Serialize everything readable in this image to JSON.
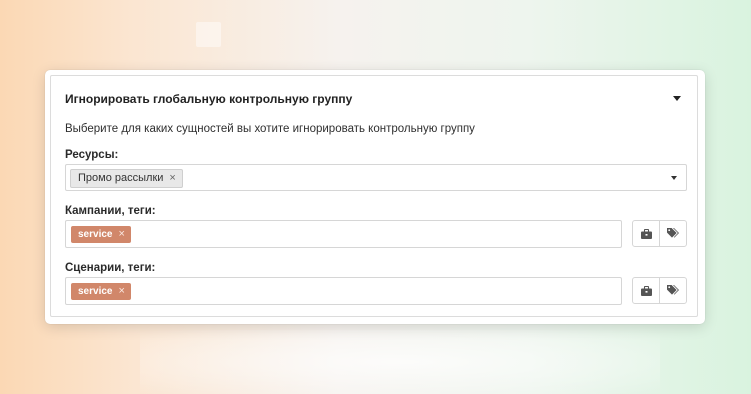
{
  "panel": {
    "title": "Игнорировать глобальную контрольную группу",
    "description": "Выберите для каких сущностей вы хотите игнорировать контрольную группу"
  },
  "resources": {
    "label": "Ресурсы:",
    "selected": [
      {
        "label": "Промо рассылки",
        "remove_symbol": "×"
      }
    ],
    "icon": "chevron-down-icon"
  },
  "campaigns": {
    "label": "Кампании, теги:",
    "tags": [
      {
        "label": "service",
        "remove_symbol": "×"
      }
    ],
    "buttons": [
      {
        "icon": "briefcase-icon"
      },
      {
        "icon": "tags-icon"
      }
    ]
  },
  "scenarios": {
    "label": "Сценарии, теги:",
    "tags": [
      {
        "label": "service",
        "remove_symbol": "×"
      }
    ],
    "buttons": [
      {
        "icon": "briefcase-icon"
      },
      {
        "icon": "tags-icon"
      }
    ]
  },
  "colors": {
    "tag_accent": "#d1876a",
    "chip_gray": "#e8e8e8",
    "icon": "#555555"
  }
}
